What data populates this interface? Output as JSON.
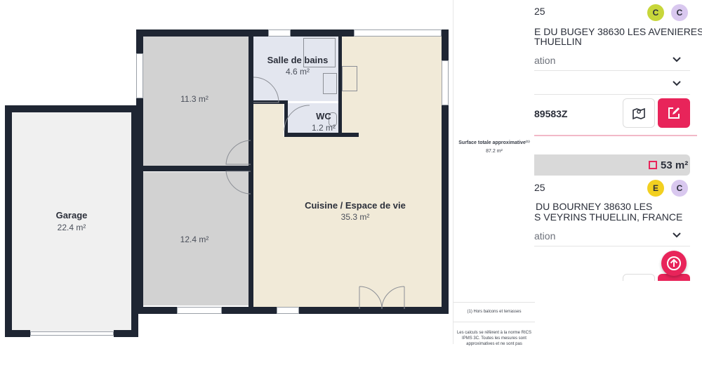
{
  "floor_plan": {
    "rooms": {
      "garage": {
        "name": "Garage",
        "area": "22.4 m²"
      },
      "room_top": {
        "name": "",
        "area": "11.3 m²"
      },
      "room_bottom": {
        "name": "",
        "area": "12.4 m²"
      },
      "bathroom": {
        "name": "Salle de bains",
        "area": "4.6 m²"
      },
      "wc": {
        "name": "WC",
        "area": "1.2 m²"
      },
      "kitchen": {
        "name": "Cuisine / Espace de vie",
        "area": "35.3 m²"
      }
    },
    "summary": {
      "label": "Surface totale approximative⁽¹⁾",
      "total": "87.2 m²",
      "footnote": "(1) Hors balcons et terrasses",
      "note_lines": [
        "Les calculs se réfèrent à la norme RICS",
        "IPMS 3C. Toutes les mesures sont",
        "approximatives et ne sont pas"
      ]
    }
  },
  "listings": [
    {
      "date_partial": "25",
      "energy_badge": "C",
      "ges_badge": "C",
      "address_line1": "E DU BUGEY 38630 LES AVENIERES",
      "address_line2": "THUELLIN",
      "info_row": "ation",
      "reference": "89583Z"
    },
    {
      "surface": "53 m²",
      "date_partial": "25",
      "energy_badge": "E",
      "ges_badge": "C",
      "address_line1": "DU BOURNEY 38630 LES",
      "address_line2": "S VEYRINS THUELLIN, FRANCE",
      "info_row": "ation"
    }
  ],
  "colors": {
    "accent": "#e8245a",
    "badge_c_energy": "#c7d63a",
    "badge_c_ges": "#d9c8ef",
    "badge_e": "#f2d020",
    "kitchen_fill": "#f1ead8",
    "room_fill": "#d2d2d2",
    "garage_fill": "#f0f0f0",
    "bath_fill": "#e3e6ef"
  },
  "icons": {
    "map": "map-pin-icon",
    "edit": "edit-icon",
    "surface": "area-icon",
    "scroll_top": "arrow-up-icon"
  }
}
